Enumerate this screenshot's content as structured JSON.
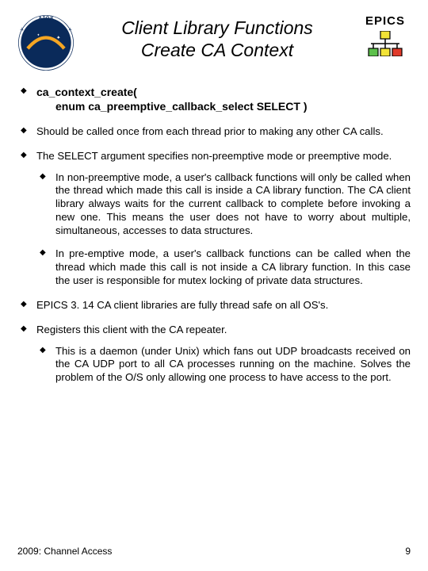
{
  "header": {
    "title_l1": "Client Library Functions",
    "title_l2": "Create CA Context",
    "epics_label": "EPICS"
  },
  "bullets": {
    "b1_l1": "ca_context_create(",
    "b1_l2": "enum ca_preemptive_callback_select SELECT )",
    "b2": "Should be called once from each thread prior to making any other CA calls.",
    "b3": "The SELECT argument specifies non-preemptive mode or preemptive mode.",
    "b3_s1": "In non-preemptive mode, a user's callback functions will only be called when the thread which made this call is inside a CA library function. The CA client library always waits for the current callback to complete before invoking a new one. This means the user does not have to worry about multiple, simultaneous, accesses to data structures.",
    "b3_s2": "In pre-emptive mode, a user's callback functions can be called when the thread which made this call is not inside a CA library function. In this case the user is responsible for mutex locking of private data structures.",
    "b4": "EPICS 3. 14 CA client libraries are fully thread safe on all OS's.",
    "b5": "Registers this client with the CA repeater.",
    "b5_s1": "This is a daemon (under Unix)  which fans out UDP broadcasts received on the  CA UDP port to all CA processes running on the machine. Solves the problem of the O/S only allowing one process to have access to the port."
  },
  "footer": {
    "left": "2009: Channel Access",
    "right": "9"
  }
}
